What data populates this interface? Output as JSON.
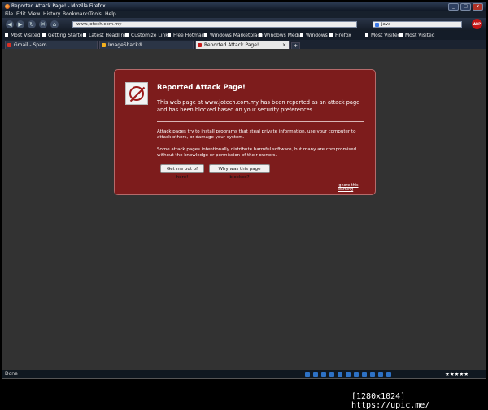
{
  "window": {
    "title": "Reported Attack Page! - Mozilla Firefox"
  },
  "menu": [
    "File",
    "Edit",
    "View",
    "History",
    "Bookmarks",
    "Tools",
    "Help"
  ],
  "nav": {
    "url": "www.jotech.com.my",
    "search": "java",
    "abp": "ABP"
  },
  "bookmarks": [
    "Most Visited",
    "Getting Started",
    "Latest Headlines",
    "Customize Links",
    "Free Hotmail",
    "Windows Marketplace",
    "Windows Media",
    "Windows",
    "Firefox",
    "Most Visited",
    "Most Visited"
  ],
  "tabs": [
    {
      "label": "Gmail - Spam"
    },
    {
      "label": "ImageShack®"
    },
    {
      "label": "Reported Attack Page!"
    }
  ],
  "warning": {
    "title": "Reported Attack Page!",
    "p1": "This web page at www.jotech.com.my has been reported as an attack page and has been blocked based on your security preferences.",
    "p2": "Attack pages try to install programs that steal private information, use your computer to attack others, or damage your system.",
    "p3": "Some attack pages intentionally distribute harmful software, but many are compromised without the knowledge or permission of their owners.",
    "btn_out": "Get me out of here!",
    "btn_why": "Why was this page blocked?",
    "ignore": "Ignore this warning"
  },
  "status": {
    "text": "Done",
    "stars": "★★★★★"
  },
  "footer": {
    "dims": "[1280x1024]",
    "site": "https://upic.me/"
  },
  "colors": {
    "warning_bg": "#7d1c1c",
    "page_bg": "#323232",
    "chrome": "#141c28"
  }
}
